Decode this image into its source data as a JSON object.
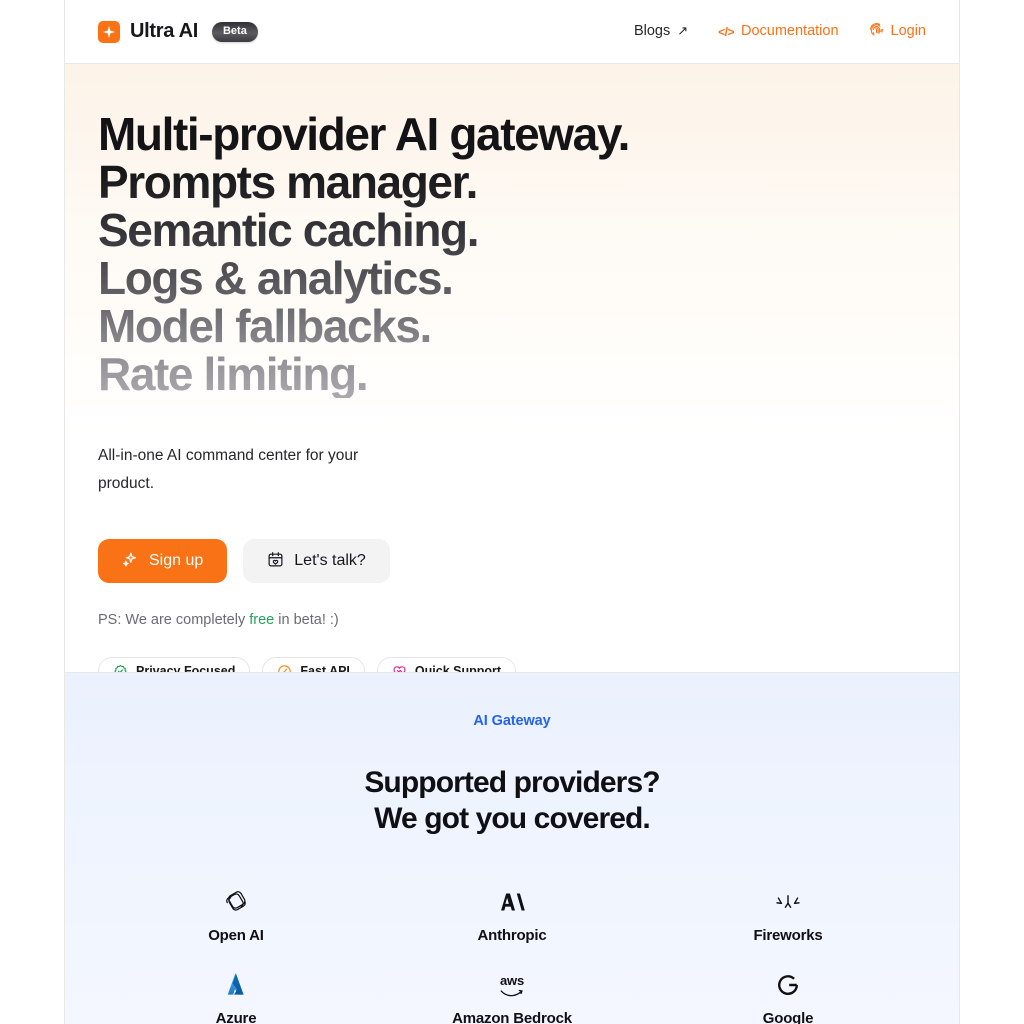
{
  "navbar": {
    "brand_name": "Ultra AI",
    "brand_icon": "sparkle-logo-icon",
    "beta_label": "Beta",
    "links": [
      {
        "label": "Blogs",
        "icon": "arrow-up-right-icon",
        "accent": false
      },
      {
        "label": "Documentation",
        "icon": "code-brackets-icon",
        "accent": true
      },
      {
        "label": "Login",
        "icon": "fingerprint-icon",
        "accent": true
      }
    ]
  },
  "hero": {
    "headline_lines": [
      "Multi-provider AI gateway.",
      "Prompts manager.",
      "Semantic caching.",
      "Logs & analytics.",
      "Model fallbacks.",
      "Rate limiting."
    ],
    "subtitle": "All-in-one AI command center for your product.",
    "primary_cta": {
      "label": "Sign up",
      "icon": "sparkles-icon"
    },
    "secondary_cta": {
      "label": "Let's talk?",
      "icon": "calendar-heart-icon"
    },
    "ps_prefix": "PS: We are completely ",
    "ps_highlight": "free",
    "ps_suffix": " in beta! :)",
    "badges": [
      {
        "label": "Privacy Focused",
        "icon": "verified-check-icon",
        "color": "#17a34a"
      },
      {
        "label": "Fast API",
        "icon": "gauge-icon",
        "color": "#ef8c1b"
      },
      {
        "label": "Quick Support",
        "icon": "heart-handshake-icon",
        "color": "#e0218a"
      }
    ]
  },
  "providers_section": {
    "eyebrow": "AI Gateway",
    "title_lines": [
      "Supported providers?",
      "We got you covered."
    ],
    "providers": [
      {
        "name": "Open AI",
        "logo": "openai-logo-icon"
      },
      {
        "name": "Anthropic",
        "logo": "anthropic-logo-icon"
      },
      {
        "name": "Fireworks",
        "logo": "fireworks-logo-icon"
      },
      {
        "name": "Azure",
        "logo": "azure-logo-icon"
      },
      {
        "name": "Amazon Bedrock",
        "logo": "aws-logo-icon"
      },
      {
        "name": "Google",
        "logo": "google-logo-icon"
      }
    ]
  },
  "colors": {
    "accent_orange": "#f97316",
    "accent_blue": "#2563eb",
    "free_green": "#22a45d",
    "hero_bg_top": "#fdf3e8",
    "providers_bg": "#ebf1fd"
  }
}
